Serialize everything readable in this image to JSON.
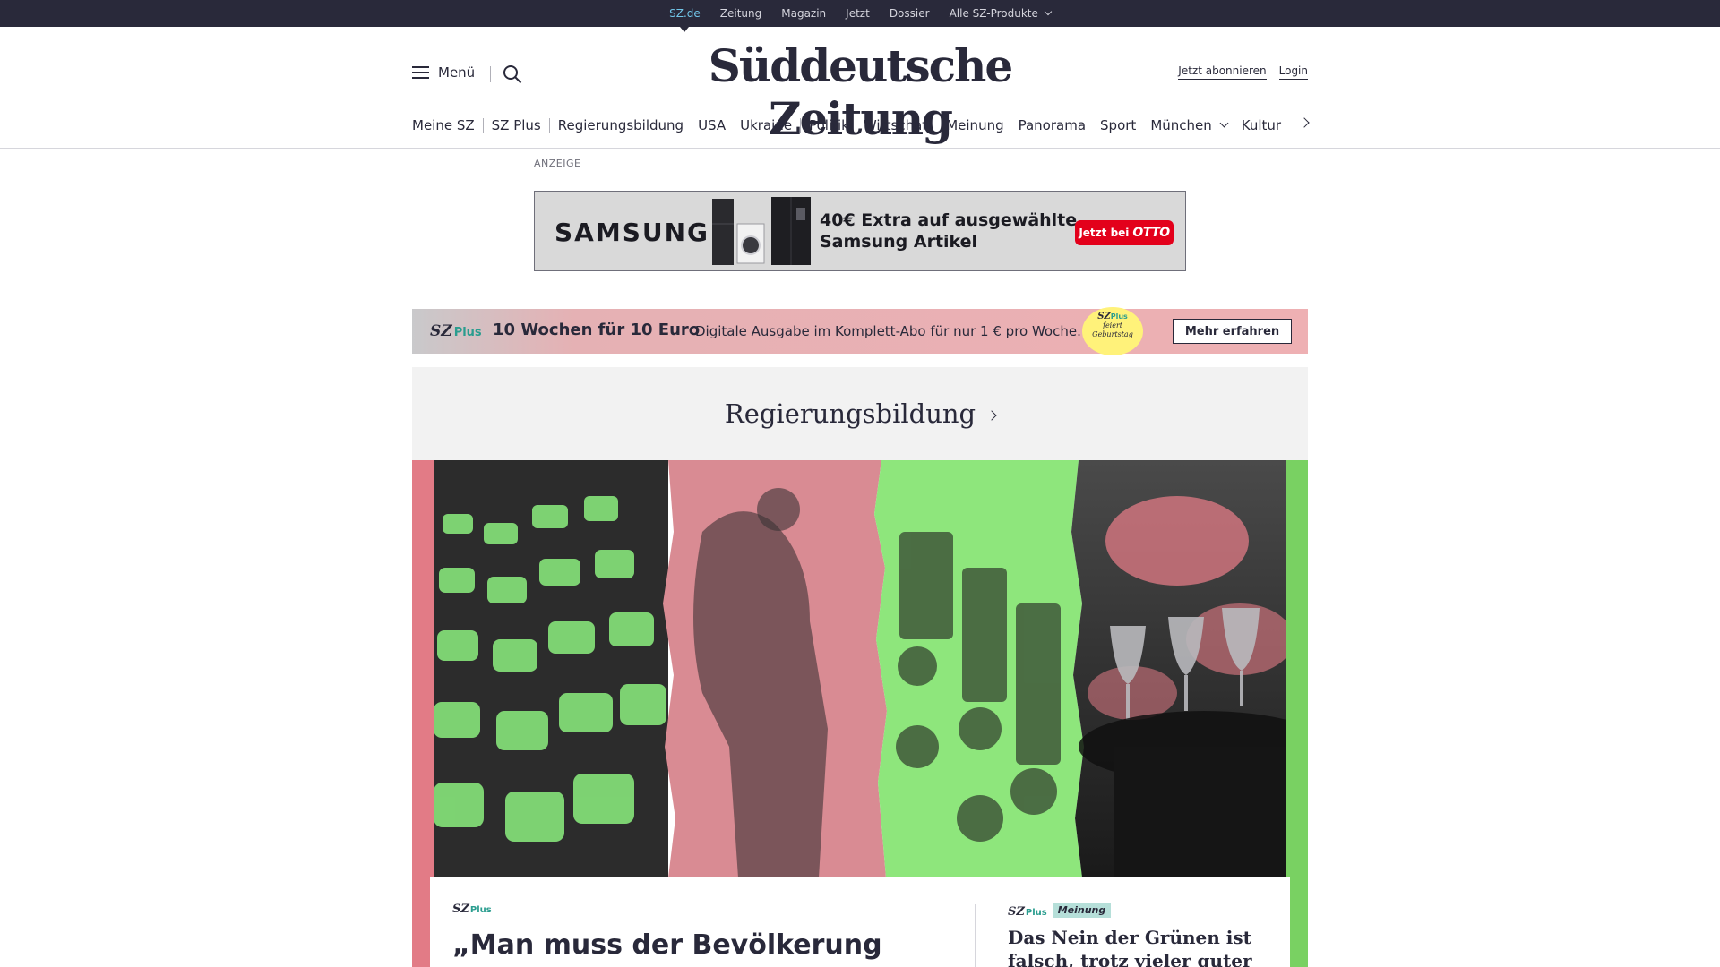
{
  "topbar": {
    "links": [
      "SZ.de",
      "Zeitung",
      "Magazin",
      "Jetzt",
      "Dossier"
    ],
    "products_label": "Alle SZ-Produkte"
  },
  "header": {
    "menu_label": "Menü",
    "logo_text": "Süddeutsche Zeitung",
    "subscribe_label": "Jetzt abonnieren",
    "login_label": "Login"
  },
  "nav": {
    "items": [
      "Meine SZ",
      "SZ Plus",
      "Regierungsbildung",
      "USA",
      "Ukraine",
      "Politik",
      "Wirtschaft",
      "Meinung",
      "Panorama",
      "Sport",
      "München",
      "Kultur"
    ]
  },
  "ad": {
    "label": "ANZEIGE",
    "brand": "SAMSUNG",
    "text": "40€ Extra auf ausgewählte Samsung Artikel",
    "cta_prefix": "Jetzt bei",
    "cta_brand": "OTTO"
  },
  "promo": {
    "logo": "SZ",
    "logo_plus": "Plus",
    "headline": "10 Wochen für 10 Euro",
    "description": "Digitale Ausgabe im Komplett-Abo für nur 1 € pro Woche.",
    "badge_line1": "SZ",
    "badge_plus": "Plus",
    "badge_line2": "feiert",
    "badge_line3": "Geburtstag",
    "button_label": "Mehr erfahren"
  },
  "section": {
    "title": "Regierungsbildung"
  },
  "teaser": {
    "main_kicker": "SZ",
    "main_kicker_plus": "Plus",
    "main_headline": "„Man muss der Bevölkerung reinen Wein einschenken“",
    "side_kicker": "SZ",
    "side_kicker_plus": "Plus",
    "side_tag": "Meinung",
    "side_headline": "Das Nein der Grünen ist falsch, trotz vieler guter Gründe"
  },
  "colors": {
    "topbar_bg": "#29293a",
    "active_link": "#71c5e8",
    "band_pink": "#e27b86",
    "band_green": "#79d162",
    "promo_bg": "#eeb0b3",
    "ad_cta": "#e3001b",
    "meinung_tag": "#b6dfd9"
  }
}
